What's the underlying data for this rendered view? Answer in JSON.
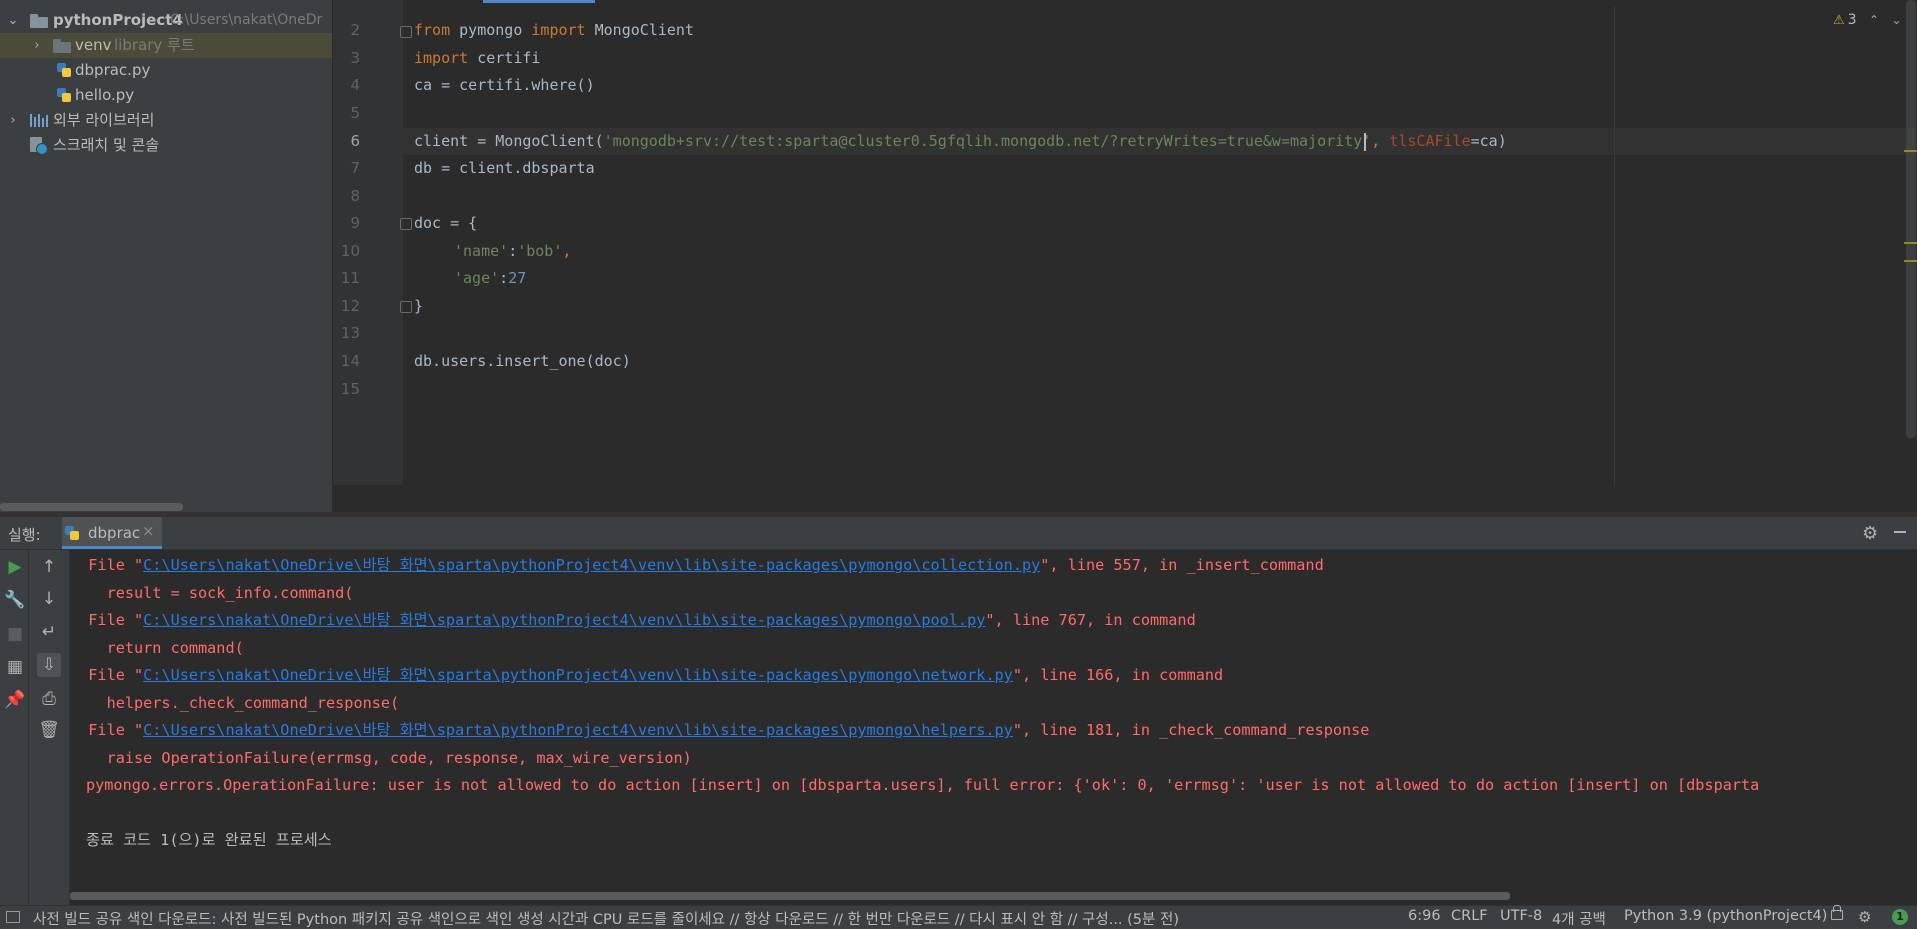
{
  "project_tree": {
    "root": {
      "name": "pythonProject4",
      "path": "C:\\Users\\nakat\\OneDr"
    },
    "venv": {
      "name": "venv",
      "hint": "library 루트"
    },
    "files": [
      "dbprac.py",
      "hello.py"
    ],
    "external_libs": "외부 라이브러리",
    "scratches": "스크래치 및 콘솔"
  },
  "editor": {
    "inspection_count": "3",
    "line_numbers": [
      "2",
      "3",
      "4",
      "5",
      "6",
      "7",
      "8",
      "9",
      "10",
      "11",
      "12",
      "13",
      "14",
      "15"
    ],
    "current_line": "6",
    "code": {
      "l2": {
        "kw1": "from",
        "mod": " pymongo ",
        "kw2": "import",
        "rest": " MongoClient"
      },
      "l3": {
        "kw": "import",
        "rest": " certifi"
      },
      "l4": "ca = certifi.where()",
      "l6": {
        "pre": "client = MongoClient(",
        "str": "'mongodb+srv://test:sparta@cluster0.5gfqlih.mongodb.net/?retryWrites=true&w=majority'",
        "sep": ", ",
        "param": "tlsCAFile",
        "post": "=ca)"
      },
      "l7": "db = client.dbsparta",
      "l9": "doc = {",
      "l10": {
        "key": "'name'",
        "colon": ":",
        "val": "'bob'",
        "comma": ","
      },
      "l11": {
        "key": "'age'",
        "colon": ":",
        "val": "27"
      },
      "l12": "}",
      "l14": "db.users.insert_one(doc)"
    }
  },
  "run_panel": {
    "title": "실행:",
    "tab_label": "dbprac",
    "console": [
      {
        "pre": "  File \"",
        "link": "C:\\Users\\nakat\\OneDrive\\바탕 화면\\sparta\\pythonProject4\\venv\\lib\\site-packages\\pymongo\\collection.py",
        "post": "\", line 557, in _insert_command"
      },
      {
        "text": "    result = sock_info.command("
      },
      {
        "pre": "  File \"",
        "link": "C:\\Users\\nakat\\OneDrive\\바탕 화면\\sparta\\pythonProject4\\venv\\lib\\site-packages\\pymongo\\pool.py",
        "post": "\", line 767, in command"
      },
      {
        "text": "    return command("
      },
      {
        "pre": "  File \"",
        "link": "C:\\Users\\nakat\\OneDrive\\바탕 화면\\sparta\\pythonProject4\\venv\\lib\\site-packages\\pymongo\\network.py",
        "post": "\", line 166, in command"
      },
      {
        "text": "    helpers._check_command_response("
      },
      {
        "pre": "  File \"",
        "link": "C:\\Users\\nakat\\OneDrive\\바탕 화면\\sparta\\pythonProject4\\venv\\lib\\site-packages\\pymongo\\helpers.py",
        "post": "\", line 181, in _check_command_response"
      },
      {
        "text": "    raise OperationFailure(errmsg, code, response, max_wire_version)"
      },
      {
        "text": "pymongo.errors.OperationFailure: user is not allowed to do action [insert] on [dbsparta.users], full error: {'ok': 0, 'errmsg': 'user is not allowed to do action [insert] on [dbsparta"
      },
      {
        "text": ""
      },
      {
        "text": "종료 코드 1(으)로 완료된 프로세스"
      }
    ]
  },
  "status_bar": {
    "message": "사전 빌드 공유 색인 다운로드: 사전 빌드된 Python 패키지 공유 색인으로 색인 생성 시간과 CPU 로드를 줄이세요 // 항상 다운로드 // 한 번만 다운로드 // 다시 표시 안 함 // 구성... (5분 전)",
    "position": "6:96",
    "line_ending": "CRLF",
    "encoding": "UTF-8",
    "indent": "4개 공백",
    "interpreter": "Python 3.9 (pythonProject4)",
    "notifications": "1"
  }
}
